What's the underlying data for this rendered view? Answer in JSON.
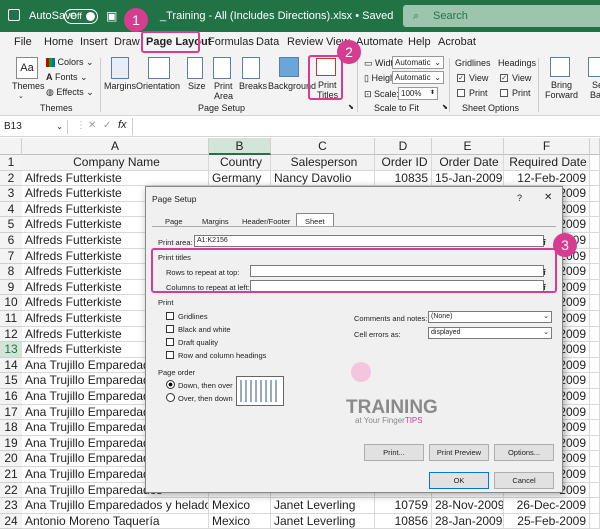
{
  "titlebar": {
    "autosave_label": "AutoSave",
    "autosave_state": "Off",
    "filename": "_Training - All (Includes Directions).xlsx • Saved",
    "search_placeholder": "Search"
  },
  "menu": [
    "File",
    "Home",
    "Insert",
    "Draw",
    "Page Layout",
    "Formulas",
    "Data",
    "Review",
    "View",
    "Automate",
    "Help",
    "Acrobat"
  ],
  "ribbon": {
    "themes": {
      "themes_label": "Themes",
      "colors_label": "Colors",
      "fonts_label": "Fonts",
      "effects_label": "Effects",
      "group_label": "Themes"
    },
    "page_setup": {
      "margins": "Margins",
      "orientation": "Orientation",
      "size": "Size",
      "print_area_1": "Print",
      "print_area_2": "Area",
      "breaks": "Breaks",
      "background": "Background",
      "print_titles_1": "Print",
      "print_titles_2": "Titles",
      "group_label": "Page Setup"
    },
    "scale": {
      "width_label": "Width:",
      "width_value": "Automatic",
      "height_label": "Height:",
      "height_value": "Automatic",
      "scale_label": "Scale:",
      "scale_value": "100%",
      "group_label": "Scale to Fit"
    },
    "sheet_options": {
      "gridlines": "Gridlines",
      "headings": "Headings",
      "view1": "View",
      "print1": "Print",
      "view2": "View",
      "print2": "Print",
      "group_label": "Sheet Options"
    },
    "arrange": {
      "bring_forward_1": "Bring",
      "bring_forward_2": "Forward",
      "send_1": "Se",
      "send_2": "Back"
    }
  },
  "formula_bar": {
    "cell_ref": "B13",
    "fx": "fx",
    "cancel": "✕",
    "enter": "✓"
  },
  "columns": [
    "A",
    "B",
    "C",
    "D",
    "E",
    "F"
  ],
  "header_row": [
    "Company Name",
    "Country",
    "Salesperson",
    "Order ID",
    "Order Date",
    "Required Date"
  ],
  "rows": [
    {
      "num": "2",
      "cells": [
        "Alfreds Futterkiste",
        "Germany",
        "Nancy Davolio",
        "10835",
        "15-Jan-2009",
        "12-Feb-2009"
      ]
    },
    {
      "num": "3",
      "cells": [
        "Alfreds Futterkiste",
        "",
        "",
        "",
        "",
        "2009"
      ]
    },
    {
      "num": "4",
      "cells": [
        "Alfreds Futterkiste",
        "",
        "",
        "",
        "",
        "2009"
      ]
    },
    {
      "num": "5",
      "cells": [
        "Alfreds Futterkiste",
        "",
        "",
        "",
        "",
        "2009"
      ]
    },
    {
      "num": "6",
      "cells": [
        "Alfreds Futterkiste",
        "",
        "",
        "",
        "",
        "2009"
      ]
    },
    {
      "num": "7",
      "cells": [
        "Alfreds Futterkiste",
        "",
        "",
        "",
        "",
        "2009"
      ]
    },
    {
      "num": "8",
      "cells": [
        "Alfreds Futterkiste",
        "",
        "",
        "",
        "",
        "2009"
      ]
    },
    {
      "num": "9",
      "cells": [
        "Alfreds Futterkiste",
        "",
        "",
        "",
        "",
        "2009"
      ]
    },
    {
      "num": "10",
      "cells": [
        "Alfreds Futterkiste",
        "",
        "",
        "",
        "",
        "2009"
      ]
    },
    {
      "num": "11",
      "cells": [
        "Alfreds Futterkiste",
        "",
        "",
        "",
        "",
        "2009"
      ]
    },
    {
      "num": "12",
      "cells": [
        "Alfreds Futterkiste",
        "",
        "",
        "",
        "",
        "2009"
      ]
    },
    {
      "num": "13",
      "cells": [
        "Alfreds Futterkiste",
        "",
        "",
        "",
        "",
        "2009"
      ]
    },
    {
      "num": "14",
      "cells": [
        "Ana Trujillo Emparedados",
        "",
        "",
        "",
        "",
        "2009"
      ]
    },
    {
      "num": "15",
      "cells": [
        "Ana Trujillo Emparedados",
        "",
        "",
        "",
        "",
        "2009"
      ]
    },
    {
      "num": "16",
      "cells": [
        "Ana Trujillo Emparedados",
        "",
        "",
        "",
        "",
        "2009"
      ]
    },
    {
      "num": "17",
      "cells": [
        "Ana Trujillo Emparedados",
        "",
        "",
        "",
        "",
        "2009"
      ]
    },
    {
      "num": "18",
      "cells": [
        "Ana Trujillo Emparedados",
        "",
        "",
        "",
        "",
        "2009"
      ]
    },
    {
      "num": "19",
      "cells": [
        "Ana Trujillo Emparedados",
        "",
        "",
        "",
        "",
        "2009"
      ]
    },
    {
      "num": "20",
      "cells": [
        "Ana Trujillo Emparedados",
        "",
        "",
        "",
        "",
        "2009"
      ]
    },
    {
      "num": "21",
      "cells": [
        "Ana Trujillo Emparedados",
        "",
        "",
        "",
        "",
        "2009"
      ]
    },
    {
      "num": "22",
      "cells": [
        "Ana Trujillo Emparedados",
        "",
        "",
        "",
        "",
        "2009"
      ]
    },
    {
      "num": "23",
      "cells": [
        "Ana Trujillo Emparedados y helados",
        "Mexico",
        "Janet Leverling",
        "10759",
        "28-Nov-2009",
        "26-Dec-2009"
      ]
    },
    {
      "num": "24",
      "cells": [
        "Antonio Moreno Taquería",
        "Mexico",
        "Janet Leverling",
        "10856",
        "28-Jan-2009",
        "25-Feb-2009"
      ]
    }
  ],
  "dialog": {
    "title": "Page Setup",
    "help": "?",
    "close": "✕",
    "tabs": [
      "Page",
      "Margins",
      "Header/Footer",
      "Sheet"
    ],
    "print_area_label": "Print area:",
    "print_area_value": "A1:K2156",
    "print_titles_label": "Print titles",
    "rows_repeat_label": "Rows to repeat at top:",
    "rows_repeat_value": "",
    "cols_repeat_label": "Columns to repeat at left:",
    "cols_repeat_value": "",
    "print_label": "Print",
    "gridlines": "Gridlines",
    "black_white": "Black and white",
    "draft_quality": "Draft quality",
    "row_col_headings": "Row and column headings",
    "comments_label": "Comments and notes:",
    "comments_value": "(None)",
    "cell_errors_label": "Cell errors as:",
    "cell_errors_value": "displayed",
    "page_order_label": "Page order",
    "down_then_over": "Down, then over",
    "over_then_down": "Over, then down",
    "print_btn": "Print...",
    "print_preview_btn": "Print Preview",
    "options_btn": "Options...",
    "ok_btn": "OK",
    "cancel_btn": "Cancel"
  },
  "watermark": {
    "line1": "TRAINING",
    "line2": "at Your Finger",
    "line3": "TIPS"
  },
  "callouts": [
    "1",
    "2",
    "3"
  ],
  "colors": {
    "excel_green": "#217346",
    "callout_pink": "#d63c8f",
    "selected_cell_border": "#217346"
  }
}
